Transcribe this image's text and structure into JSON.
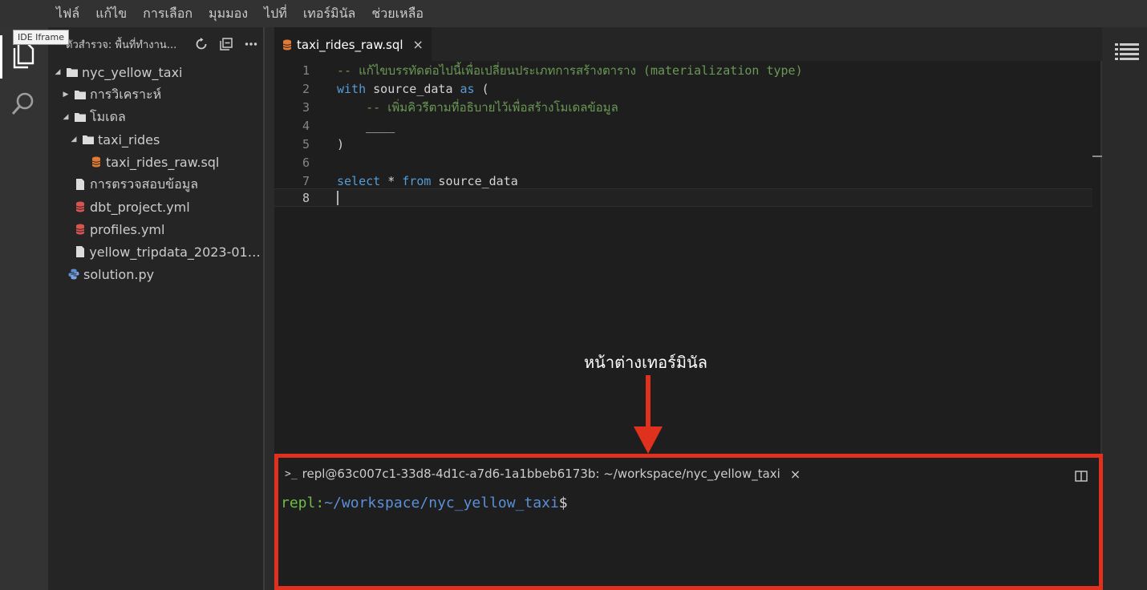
{
  "menu": [
    "ไฟล์",
    "แก้ไข",
    "การเลือก",
    "มุมมอง",
    "ไปที่",
    "เทอร์มินัล",
    "ช่วยเหลือ"
  ],
  "tooltip": "IDE Iframe",
  "explorer": {
    "title": "ตัวสำรวจ: พื้นที่ทำงาน...",
    "tree": [
      {
        "label": "nyc_yellow_taxi",
        "type": "folder",
        "expanded": true
      },
      {
        "label": "การวิเคราะห์",
        "type": "folder",
        "expanded": false
      },
      {
        "label": "โมเดล",
        "type": "folder",
        "expanded": true
      },
      {
        "label": "taxi_rides",
        "type": "folder",
        "expanded": true
      },
      {
        "label": "taxi_rides_raw.sql",
        "type": "sql"
      },
      {
        "label": "การตรวจสอบข้อมูล",
        "type": "file"
      },
      {
        "label": "dbt_project.yml",
        "type": "yml"
      },
      {
        "label": "profiles.yml",
        "type": "yml"
      },
      {
        "label": "yellow_tripdata_2023-01-p...",
        "type": "file"
      },
      {
        "label": "solution.py",
        "type": "py"
      }
    ]
  },
  "editor": {
    "tab_label": "taxi_rides_raw.sql",
    "tab_close": "×",
    "lines": [
      {
        "n": "1",
        "comment": "-- แก้ไขบรรทัดต่อไปนี้เพื่อเปลี่ยนประเภทการสร้างตาราง (materialization type)"
      },
      {
        "n": "2",
        "kw1": "with",
        "id1": " source_data ",
        "kw2": "as",
        "rest": " ("
      },
      {
        "n": "3",
        "comment": "    -- เพิ่มคิวรีตามที่อธิบายไว้เพื่อสร้างโมเดลข้อมูล"
      },
      {
        "n": "4",
        "rest": "    ____"
      },
      {
        "n": "5",
        "rest": ")"
      },
      {
        "n": "6",
        "rest": ""
      },
      {
        "n": "7",
        "kw1": "select",
        "id1": " * ",
        "kw2": "from",
        "rest": " source_data"
      },
      {
        "n": "8",
        "rest": ""
      }
    ]
  },
  "annotation": {
    "label": "หน้าต่างเทอร์มินัล",
    "color": "#e0301e"
  },
  "terminal": {
    "prompt_icon": ">_",
    "title": "repl@63c007c1-33d8-4d1c-a7d6-1a1bbeb6173b: ~/workspace/nyc_yellow_taxi",
    "close": "×",
    "user": "repl:",
    "path": "~/workspace/nyc_yellow_taxi",
    "dollar": "$"
  }
}
